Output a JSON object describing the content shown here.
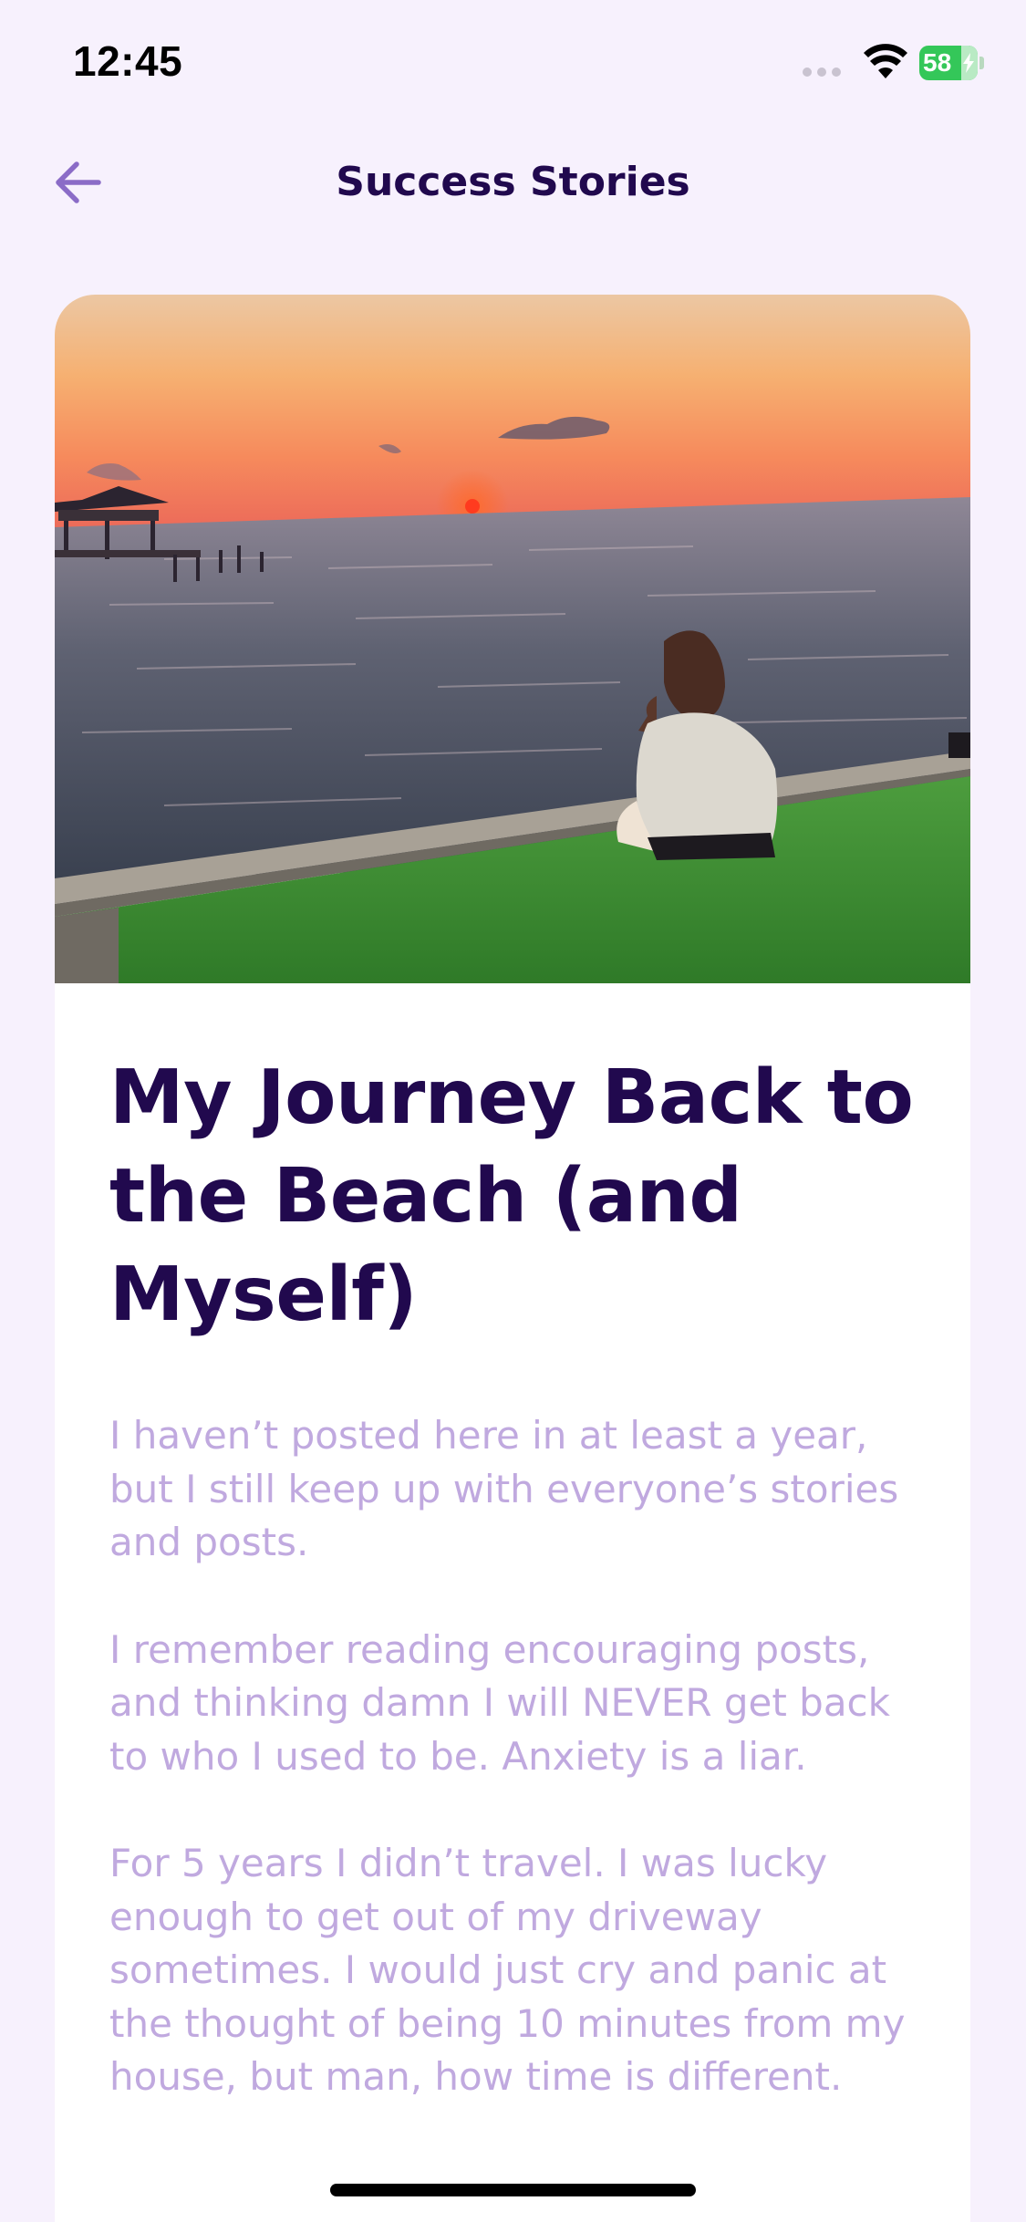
{
  "status_bar": {
    "time": "12:45",
    "battery_level": "58",
    "battery_charging": true,
    "battery_color": "#34c759"
  },
  "header": {
    "title": "Success Stories",
    "back_icon": "arrow-left-icon",
    "accent_color": "#8b6cc7"
  },
  "story": {
    "image_description": "sunset-beach-photo",
    "title": "My Journey Back to the Beach (and Myself)",
    "paragraphs": [
      "I haven’t posted here in at least a year, but I still keep up with everyone’s stories and posts.",
      "I remember reading encouraging posts, and thinking damn I will NEVER get back to who I used to be. Anxiety is a liar.",
      "For 5 years I didn’t travel. I was lucky enough to get out of my driveway sometimes. I would just cry and panic at the thought of being 10 minutes from my house, but man, how time is different."
    ],
    "title_color": "#21094e",
    "body_color": "#c0a9df"
  }
}
